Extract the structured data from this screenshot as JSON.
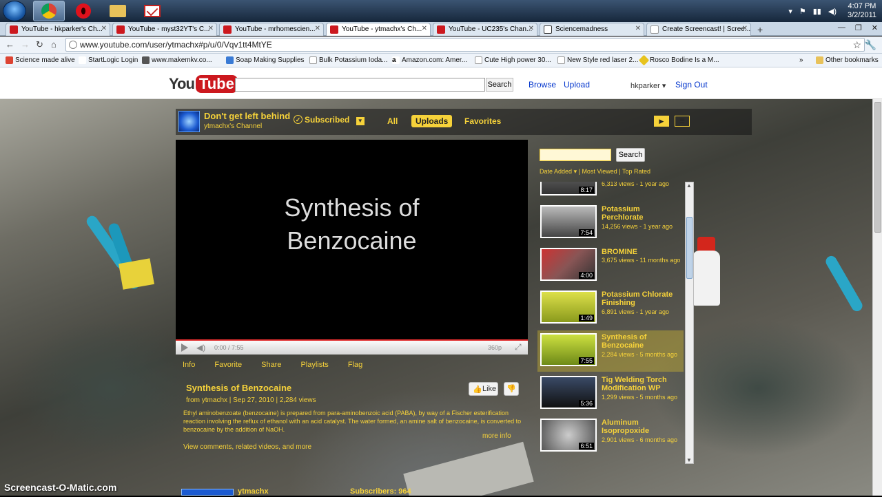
{
  "taskbar": {
    "clock_time": "4:07 PM",
    "clock_date": "3/2/2011"
  },
  "tabs": [
    {
      "label": "YouTube - hkparker's Ch..."
    },
    {
      "label": "YouTube - myst32YT's C..."
    },
    {
      "label": "YouTube - mrhomescien..."
    },
    {
      "label": "YouTube - ytmachx's Ch..."
    },
    {
      "label": "YouTube - UC235's Chan..."
    },
    {
      "label": "Sciencemadness"
    },
    {
      "label": "Create Screencast! | Scree..."
    }
  ],
  "omnibar": {
    "url": "www.youtube.com/user/ytmachx#p/u/0/Vqv1tt4MtYE"
  },
  "bookmarks": [
    {
      "label": "Science made alive"
    },
    {
      "label": "StartLogic Login"
    },
    {
      "label": "www.makemkv.co..."
    },
    {
      "label": "Soap Making Supplies"
    },
    {
      "label": "Bulk Potassium Ioda..."
    },
    {
      "label": "Amazon.com: Amer..."
    },
    {
      "label": "Cute High power 30..."
    },
    {
      "label": "New Style red laser 2..."
    },
    {
      "label": "Rosco Bodine Is a M..."
    }
  ],
  "bookmarks_more": "»",
  "other_bookmarks": "Other bookmarks",
  "yt": {
    "logo_you": "You",
    "logo_tube": "Tube",
    "search_button": "Search",
    "browse": "Browse",
    "upload": "Upload",
    "username": "hkparker",
    "signout": "Sign Out"
  },
  "channel": {
    "title": "Don't get left behind",
    "subtitle": "ytmachx's Channel",
    "subscribed": "Subscribed",
    "tabs": [
      "All",
      "Uploads",
      "Favorites"
    ],
    "active_tab": "Uploads"
  },
  "player": {
    "video_title_line1": "Synthesis of",
    "video_title_line2": "Benzocaine",
    "time": "0:00 / 7:55",
    "quality": "360p"
  },
  "video_info": {
    "tabs": [
      "Info",
      "Favorite",
      "Share",
      "Playlists",
      "Flag"
    ],
    "title": "Synthesis of Benzocaine",
    "meta": "from ytmachx | Sep 27, 2010 | 2,284 views",
    "description": "Ethyl aminobenzoate (benzocaine) is prepared from para-aminobenzoic acid (PABA), by way of a Fischer esterification reaction involving the reflux of ethanol with an acid catalyst. The water formed, an amine salt of benzocaine, is converted to benzocaine by the addition of NaOH.",
    "more_info": "more info",
    "related": "View comments, related videos, and more",
    "like": "Like",
    "footer_name": "ytmachx",
    "footer_subs": "Subscribers: 964"
  },
  "sidebar": {
    "search_button": "Search",
    "sort_date": "Date Added",
    "sort_viewed": "Most Viewed",
    "sort_rated": "Top Rated",
    "videos": [
      {
        "title": "",
        "meta": "6,313 views - 1 year ago",
        "duration": "8:17"
      },
      {
        "title": "Potassium Perchlorate",
        "meta": "14,256 views - 1 year ago",
        "duration": "7:54"
      },
      {
        "title": "BROMINE",
        "meta": "3,675 views - 11 months ago",
        "duration": "4:00"
      },
      {
        "title": "Potassium Chlorate Finishing",
        "meta": "6,891 views - 1 year ago",
        "duration": "1:49"
      },
      {
        "title": "Synthesis of Benzocaine",
        "meta": "2,284 views - 5 months ago",
        "duration": "7:55"
      },
      {
        "title": "Tig Welding Torch Modification WP",
        "meta": "1,299 views - 5 months ago",
        "duration": "5:36"
      },
      {
        "title": "Aluminum Isopropoxide",
        "meta": "2,901 views - 6 months ago",
        "duration": "6:51"
      }
    ]
  },
  "watermark": "Screencast-O-Matic.com",
  "colors": {
    "accent_yellow": "#f6d23a",
    "youtube_red": "#cc181e",
    "link_blue": "#0033cc"
  }
}
